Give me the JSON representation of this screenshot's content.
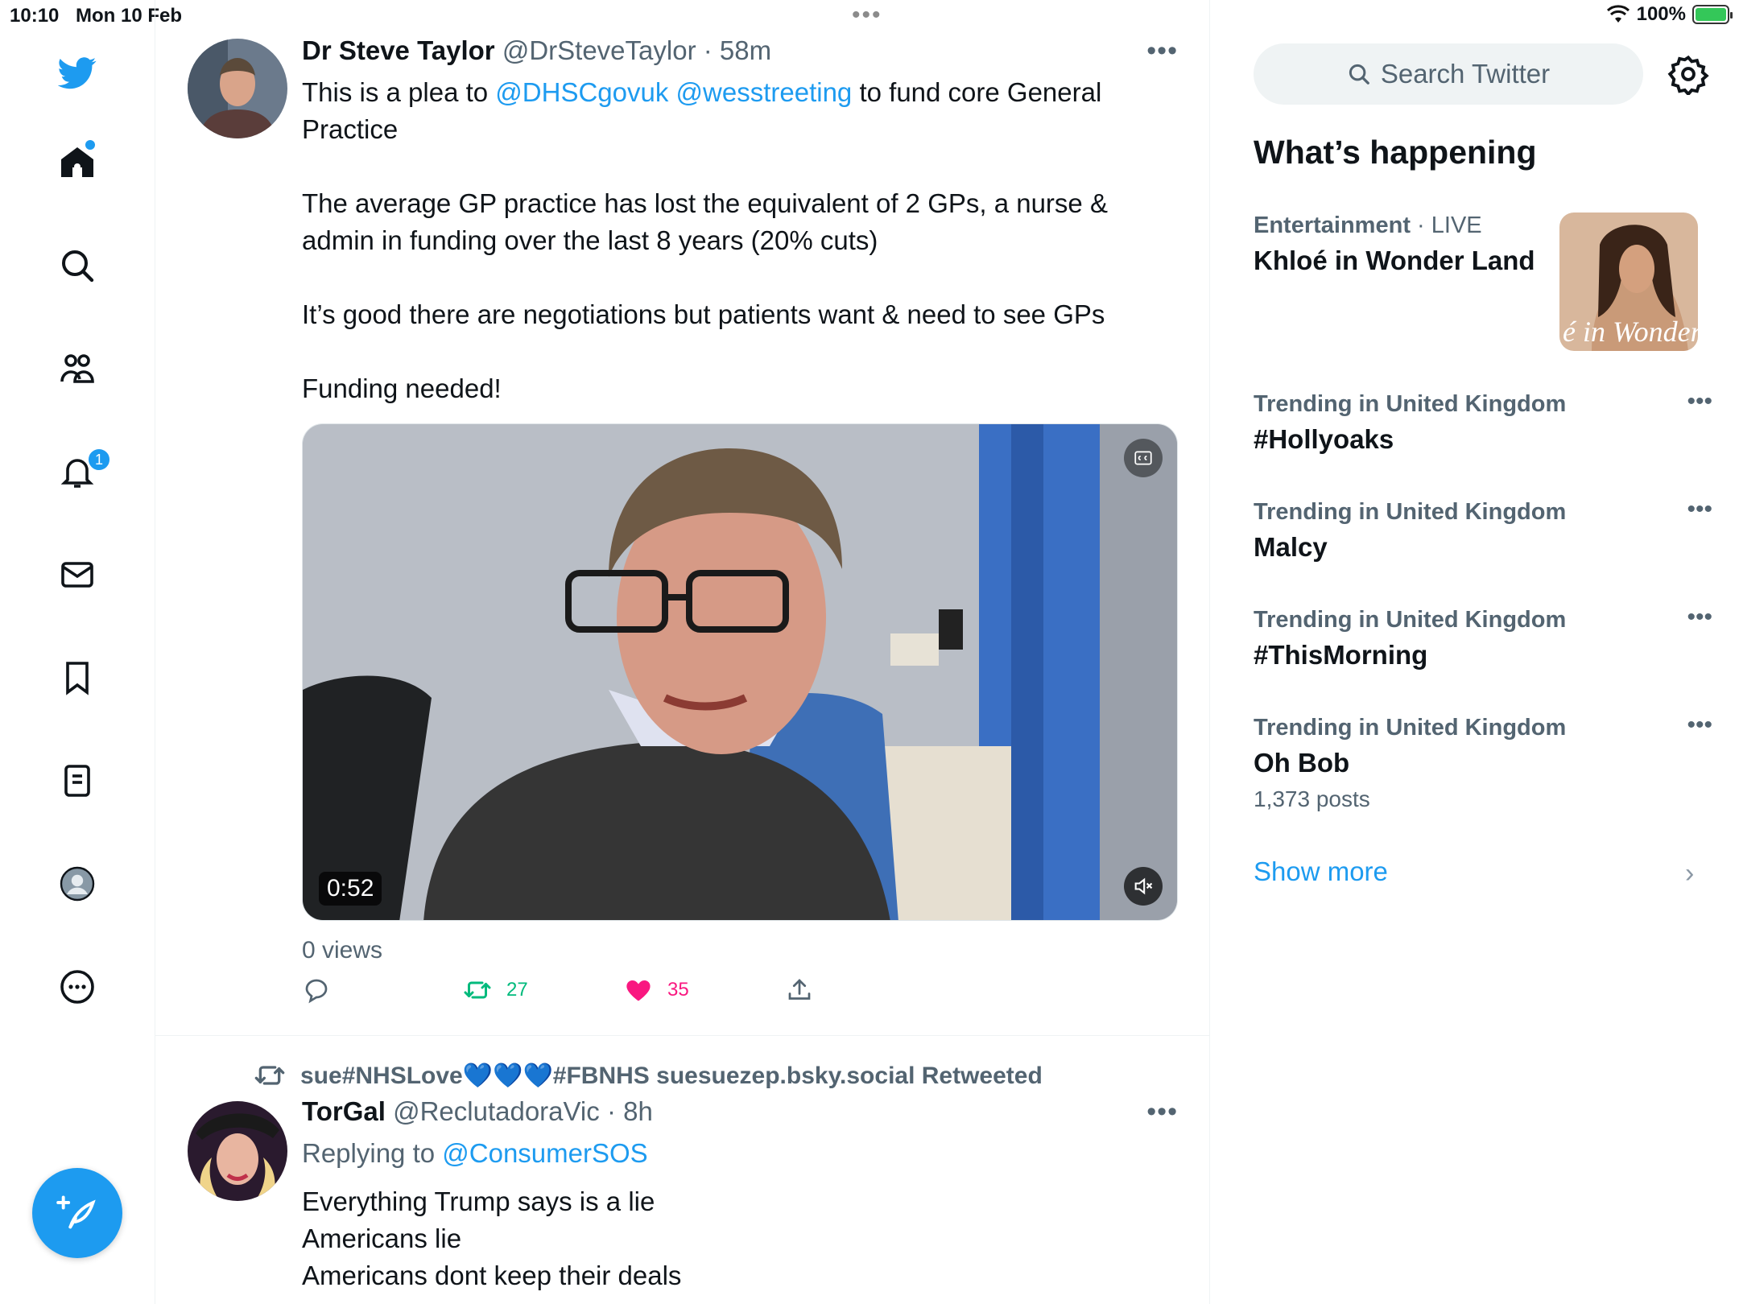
{
  "status_bar": {
    "time": "10:10",
    "date": "Mon 10 Feb",
    "battery": "100%"
  },
  "nav": {
    "notifications_badge": "1"
  },
  "tweets": [
    {
      "name": "Dr Steve Taylor",
      "handle": "@DrSteveTaylor",
      "time": "58m",
      "text": {
        "p1_pre": "This is a plea to ",
        "p1_link1": "@DHSCgovuk",
        "p1_link2": "@wesstreeting",
        "p1_post": " to fund core General Practice",
        "p2": "The average GP practice has lost the equivalent of 2 GPs, a nurse & admin in funding over the last 8 years (20% cuts)",
        "p3": "It’s good there are negotiations but patients want & need to see GPs",
        "p4": "Funding needed!"
      },
      "video_duration": "0:52",
      "views": "0 views",
      "retweets": "27",
      "likes": "35"
    },
    {
      "retweeted_by": "sue#NHSLove💙💙💙#FBNHS suesuezep.bsky.social Retweeted",
      "name": "TorGal",
      "handle": "@ReclutadoraVic",
      "time": "8h",
      "replying_label": "Replying to ",
      "replying_to": "@ConsumerSOS",
      "lines": [
        "Everything Trump says is a lie",
        "Americans lie",
        "Americans dont keep their deals"
      ]
    }
  ],
  "sidebar": {
    "search_placeholder": "Search Twitter",
    "title": "What’s happening",
    "featured": {
      "category": "Entertainment",
      "status": "LIVE",
      "name": "Khloé in Wonder Land",
      "image_text": "é in Wonder l"
    },
    "trends": [
      {
        "category": "Trending in United Kingdom",
        "name": "#Hollyoaks"
      },
      {
        "category": "Trending in United Kingdom",
        "name": "Malcy"
      },
      {
        "category": "Trending in United Kingdom",
        "name": "#ThisMorning"
      },
      {
        "category": "Trending in United Kingdom",
        "name": "Oh Bob",
        "count": "1,373 posts"
      }
    ],
    "show_more": "Show more"
  },
  "colors": {
    "accent": "#1d9bf0",
    "retweet": "#00ba7c",
    "like": "#f91880",
    "muted_text": "#536471"
  }
}
